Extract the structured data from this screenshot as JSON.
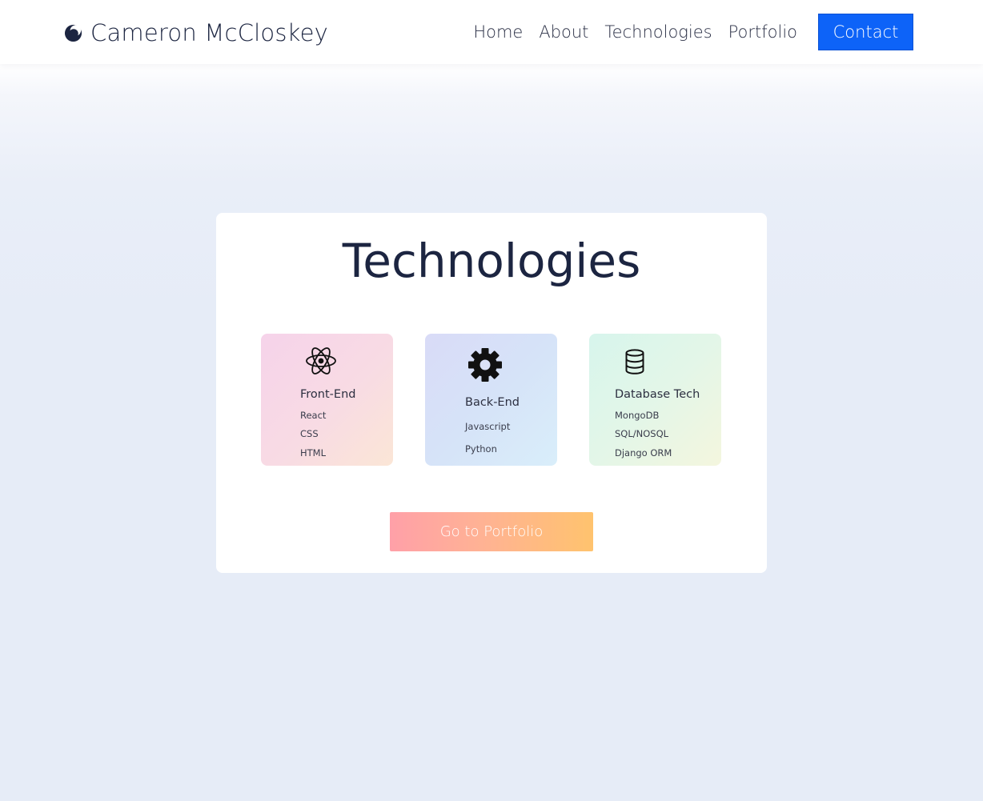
{
  "navbar": {
    "brand_name": "Cameron McCloskey",
    "brand_icon": "moon-logo-icon",
    "links": [
      "Home",
      "About",
      "Technologies",
      "Portfolio"
    ],
    "contact_label": "Contact"
  },
  "technologies": {
    "title": "Technologies",
    "cards": [
      {
        "heading": "Front-End",
        "icon": "react-atom-icon",
        "items": [
          "React",
          "CSS",
          "HTML"
        ]
      },
      {
        "heading": "Back-End",
        "icon": "gear-icon",
        "items": [
          "Javascript",
          "Python"
        ]
      },
      {
        "heading": "Database Tech",
        "icon": "database-icon",
        "items": [
          "MongoDB",
          "SQL/NOSQL",
          "Django ORM"
        ]
      }
    ],
    "cta_label": "Go to Portfolio"
  },
  "colors": {
    "primary_button": "#0d63f8",
    "title_text": "#1c2541",
    "cta_gradient_start": "#ffa0a8",
    "cta_gradient_end": "#ffc36e"
  }
}
